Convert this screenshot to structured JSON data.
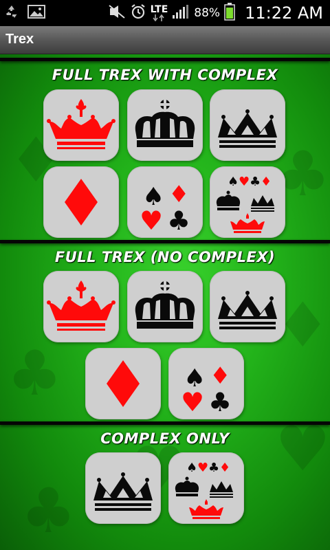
{
  "status_bar": {
    "time": "11:22 AM",
    "battery_percent": "88%",
    "network": "LTE",
    "icons": [
      "recycle-icon",
      "image-icon",
      "mute-icon",
      "alarm-icon",
      "lte-icon",
      "signal-icon",
      "battery-icon"
    ]
  },
  "app": {
    "title": "Trex"
  },
  "colors": {
    "suit_red": "#ff0a0a",
    "black": "#0a0a0a",
    "tile": "#cfcfcf",
    "felt": "#22b21a"
  },
  "sections": [
    {
      "title": "FULL TREX WITH COMPLEX",
      "tiles": [
        "red-crown-option",
        "black-crown-option",
        "black-crown-outline-option",
        "diamond-option",
        "four-suits-option",
        "complex-mix-option"
      ]
    },
    {
      "title": "FULL TREX (NO COMPLEX)",
      "tiles": [
        "red-crown-option",
        "black-crown-option",
        "black-crown-outline-option",
        "diamond-option",
        "four-suits-option"
      ]
    },
    {
      "title": "COMPLEX ONLY",
      "tiles": [
        "black-crown-outline-option",
        "complex-mix-option"
      ]
    }
  ]
}
